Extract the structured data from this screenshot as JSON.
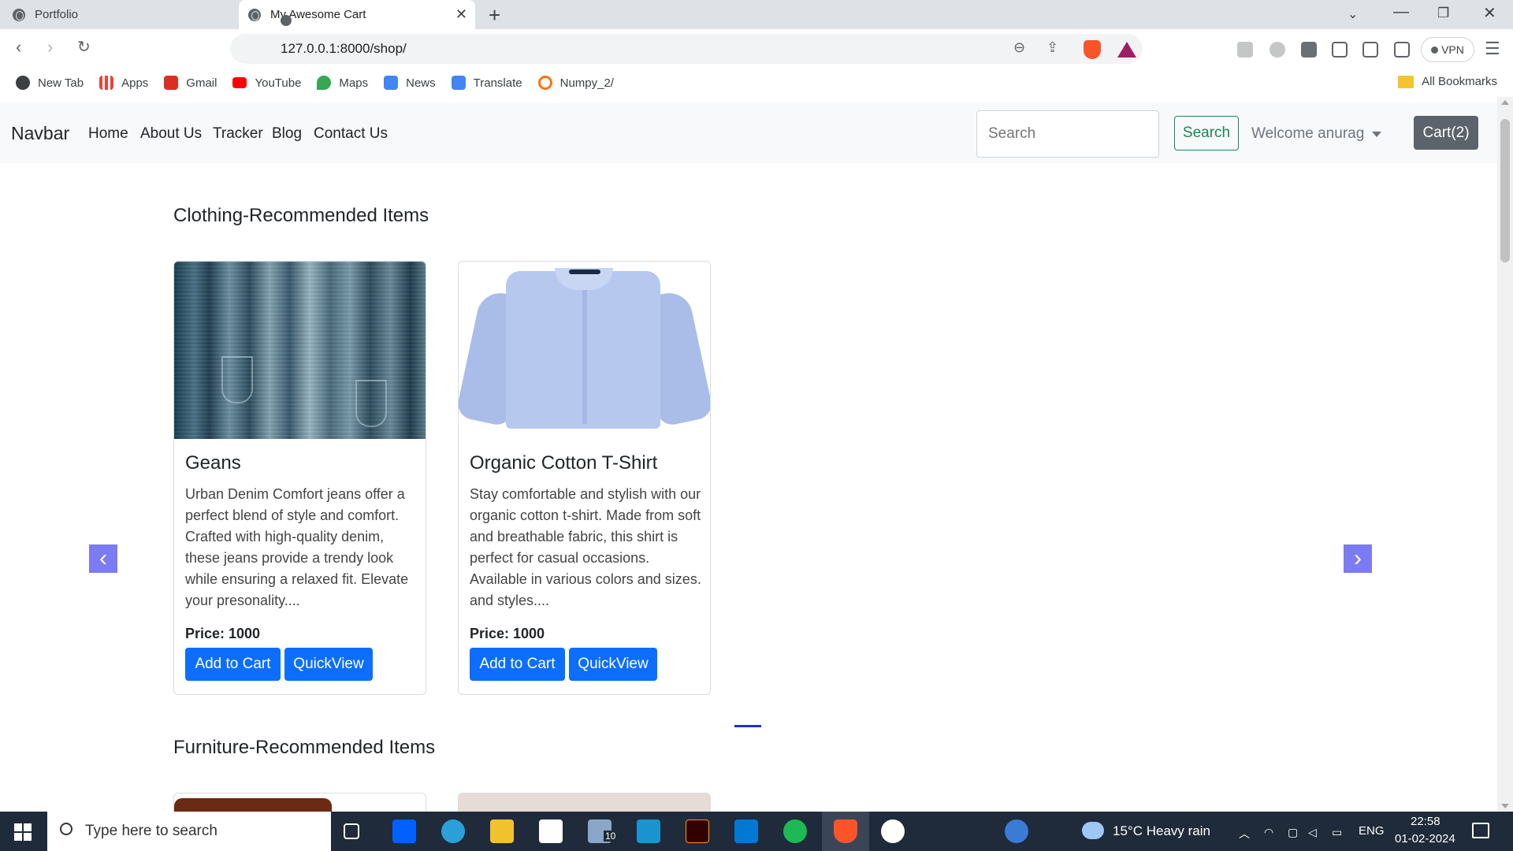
{
  "browser": {
    "tabs": [
      {
        "label": "Portfolio"
      },
      {
        "label": "My Awesome Cart"
      }
    ],
    "url": "127.0.0.1:8000/shop/",
    "vpn_label": "VPN",
    "bookmarks": [
      {
        "label": "New Tab",
        "color": "#3c4043"
      },
      {
        "label": "Apps",
        "color": "#ea4335"
      },
      {
        "label": "Gmail",
        "color": "#d93025"
      },
      {
        "label": "YouTube",
        "color": "#ff0000"
      },
      {
        "label": "Maps",
        "color": "#34a853"
      },
      {
        "label": "News",
        "color": "#4285f4"
      },
      {
        "label": "Translate",
        "color": "#4285f4"
      },
      {
        "label": "Numpy_2/",
        "color": "#f97316"
      }
    ],
    "all_bookmarks": "All Bookmarks"
  },
  "site": {
    "brand": "Navbar",
    "nav_links": [
      "Home",
      "About Us",
      "Tracker",
      "Blog",
      "Contact Us"
    ],
    "search_placeholder": "Search",
    "search_button": "Search",
    "welcome": "Welcome anurag",
    "cart_button": "Cart(2)"
  },
  "sections": [
    {
      "title": "Clothing-Recommended Items",
      "products": [
        {
          "name": "Geans",
          "description": "Urban Denim Comfort jeans offer a perfect blend of style and comfort. Crafted with high-quality denim, these jeans provide a trendy look while ensuring a relaxed fit. Elevate your presonality....",
          "price": "Price: 1000",
          "add_to_cart": "Add to Cart",
          "quickview": "QuickView"
        },
        {
          "name": "Organic Cotton T-Shirt",
          "description": "Stay comfortable and stylish with our organic cotton t-shirt. Made from soft and breathable fabric, this shirt is perfect for casual occasions. Available in various colors and sizes. and styles....",
          "price": "Price: 1000",
          "add_to_cart": "Add to Cart",
          "quickview": "QuickView"
        }
      ]
    },
    {
      "title": "Furniture-Recommended Items"
    }
  ],
  "carousel": {
    "prev_icon": "chevron-left-icon",
    "next_icon": "chevron-right-icon",
    "arrow_color": "#7b7bf3"
  },
  "taskbar": {
    "search_placeholder": "Type here to search",
    "mail_badge": "10",
    "weather": "15°C  Heavy rain",
    "language": "ENG",
    "time": "22:58",
    "date": "01-02-2024"
  },
  "colors": {
    "primary": "#0d6efd",
    "success": "#198754",
    "secondary": "#5c636a",
    "navbar_bg": "#f8f9fa"
  }
}
